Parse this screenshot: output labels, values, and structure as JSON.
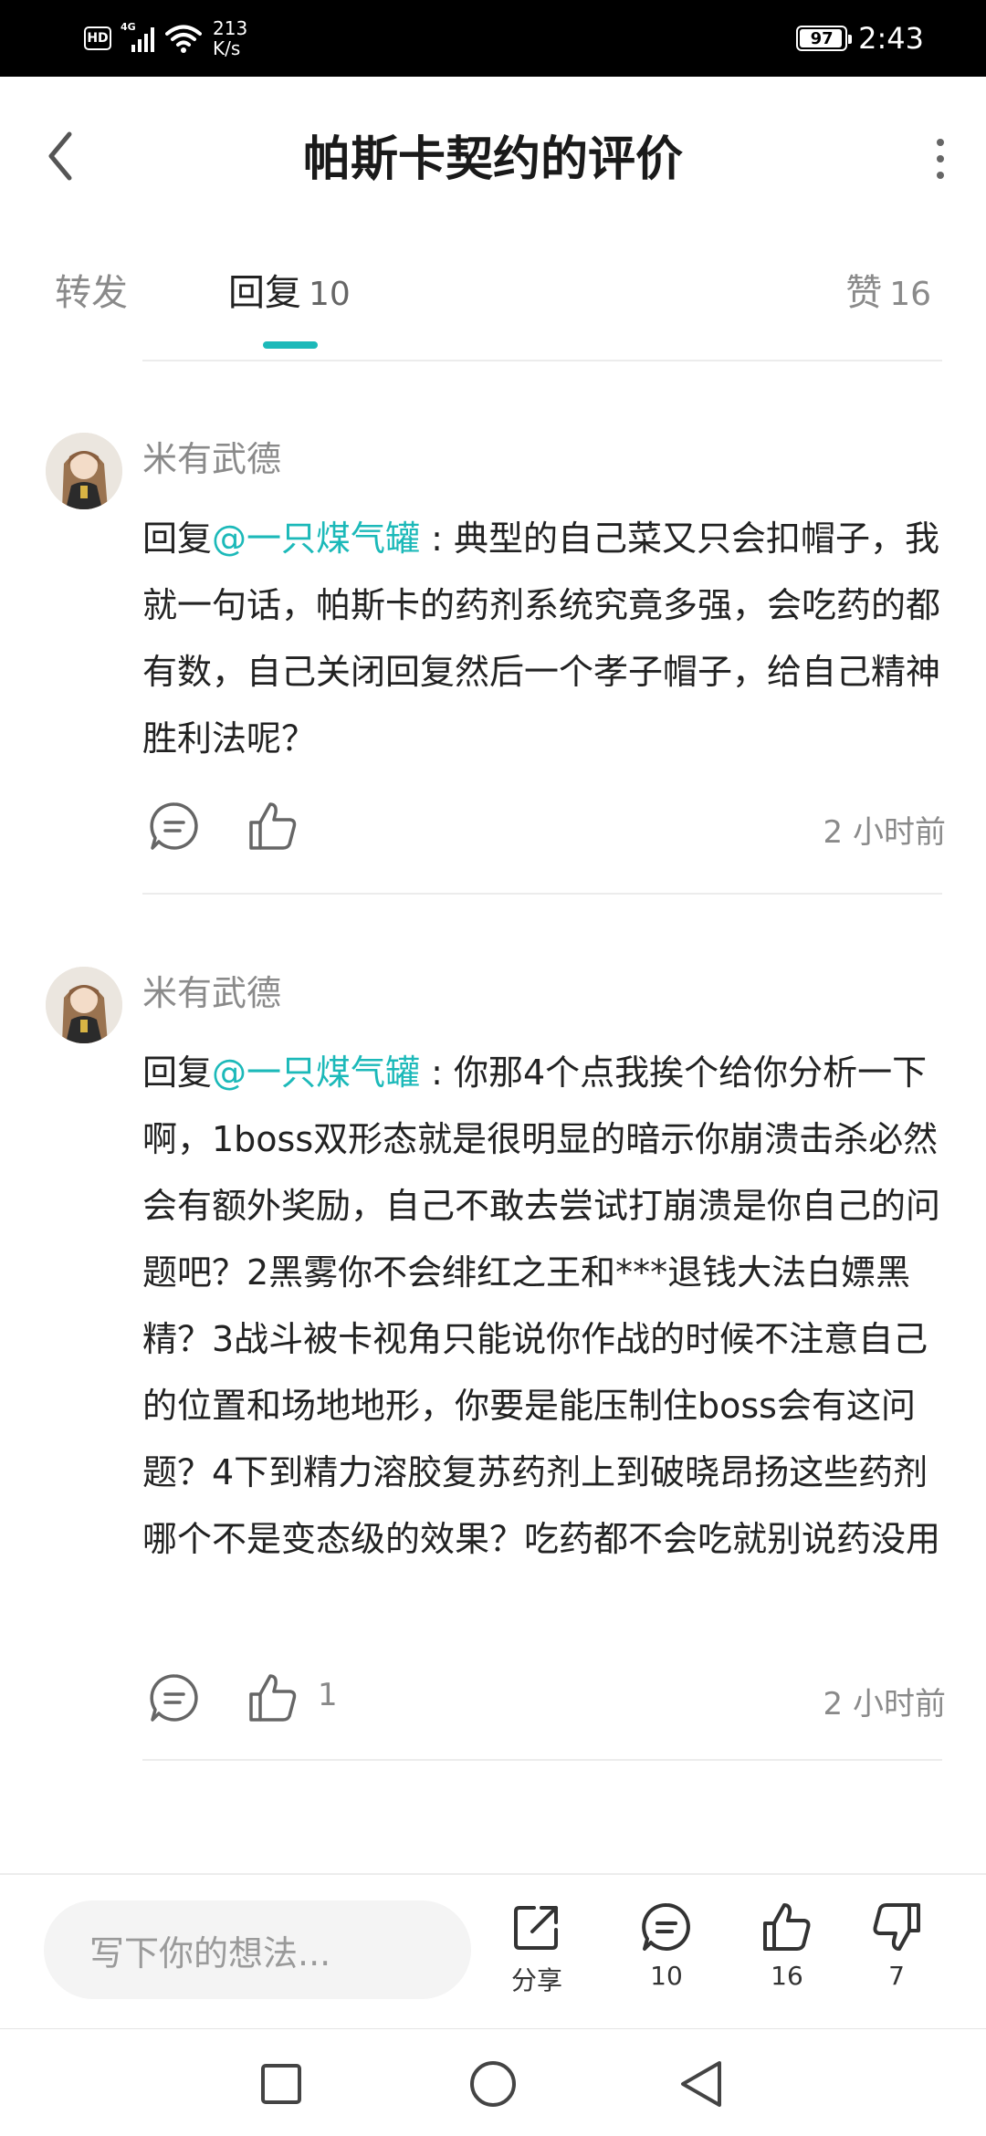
{
  "status_bar": {
    "hd": "HD",
    "network": "4G",
    "speed_value": "213",
    "speed_unit": "K/s",
    "battery": "97",
    "time": "2:43"
  },
  "header": {
    "title": "帕斯卡契约的评价"
  },
  "tabs": {
    "repost": "转发",
    "reply_label": "回复",
    "reply_count": "10",
    "like_label": "赞",
    "like_count": "16"
  },
  "comments": [
    {
      "user": "米有武德",
      "reply_prefix": "回复",
      "mention": "@一只煤气罐",
      "text": " : 典型的自己菜又只会扣帽子，我就一句话，帕斯卡的药剂系统究竟多强，会吃药的都有数，自己关闭回复然后一个孝子帽子，给自己精神胜利法呢？",
      "likes": "",
      "time": "2 小时前"
    },
    {
      "user": "米有武德",
      "reply_prefix": "回复",
      "mention": "@一只煤气罐",
      "text": " : 你那4个点我挨个给你分析一下啊，1boss双形态就是很明显的暗示你崩溃击杀必然会有额外奖励，自己不敢去尝试打崩溃是你自己的问题吧？2黑雾你不会绯红之王和***退钱大法白嫖黑精？3战斗被卡视角只能说你作战的时候不注意自己的位置和场地地形，你要是能压制住boss会有这问题？4下到精力溶胶复苏药剂上到破晓昂扬这些药剂哪个不是变态级的效果？吃药都不会吃就别说药没用",
      "likes": "1",
      "time": "2 小时前"
    }
  ],
  "bottom_bar": {
    "input_placeholder": "写下你的想法...",
    "share_label": "分享",
    "reply_count": "10",
    "like_count": "16",
    "dislike_count": "7"
  },
  "colors": {
    "accent": "#1cb9b9",
    "text": "#222222",
    "muted": "#8a8a8a"
  }
}
